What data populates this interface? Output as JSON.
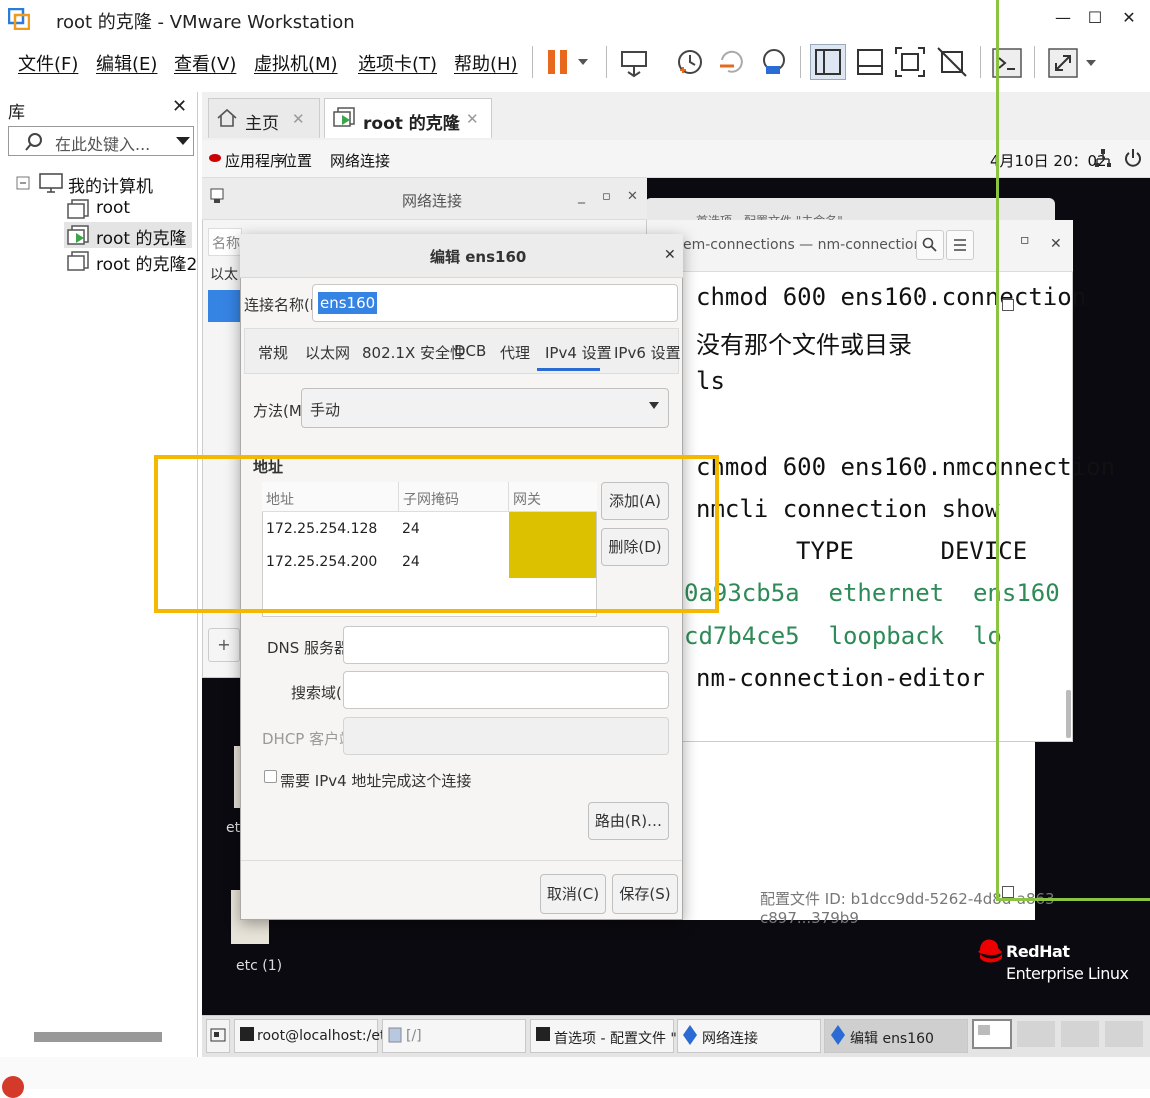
{
  "window": {
    "title": "root 的克隆 - VMware Workstation",
    "controls": [
      "—",
      "☐",
      "✕"
    ]
  },
  "menu": [
    "文件(F)",
    "编辑(E)",
    "查看(V)",
    "虚拟机(M)",
    "选项卡(T)",
    "帮助(H)"
  ],
  "library": {
    "title": "库",
    "close": "✕",
    "search_placeholder": "在此处键入...",
    "tree": {
      "root_label": "我的计算机",
      "items": [
        "root",
        "root 的克隆",
        "root 的克隆2"
      ]
    }
  },
  "tabs": [
    {
      "label": "主页",
      "close": "✕"
    },
    {
      "label": "root 的克隆",
      "close": "✕"
    }
  ],
  "guest_topbar": {
    "apps": "应用程序",
    "places": "位置",
    "net": "网络连接",
    "clock": "4月10日 20：02"
  },
  "terminal": {
    "title": "em-connections — nm-connection-editor",
    "behind_title": "首选项 - 配置文件 \"未命名\"",
    "lines": [
      {
        "text": "chmod 600 ens160.connection",
        "color": "normal"
      },
      {
        "text": "没有那个文件或目录",
        "color": "normal"
      },
      {
        "text": "ls",
        "color": "normal"
      },
      {
        "text": "chmod 600 ens160.nmconnection",
        "color": "normal"
      },
      {
        "text": "nmcli connection show",
        "color": "normal"
      },
      {
        "text": "TYPE      DEVICE",
        "color": "normal"
      },
      {
        "text": "0a93cb5a  ethernet  ens160",
        "color": "green"
      },
      {
        "text": "cd7b4ce5  loopback  lo",
        "color": "green"
      },
      {
        "text": "nm-connection-editor",
        "color": "normal"
      }
    ]
  },
  "prefs": {
    "file_id": "配置文件 ID:  b1dcc9dd-5262-4d8d-a863-c897...379b9"
  },
  "netwin": {
    "title": "网络连接",
    "name_col": "名称",
    "group": "以太",
    "add_btn": "+"
  },
  "dialog": {
    "title": "编辑 ens160",
    "close": "✕",
    "conn_name_label": "连接名称(N)",
    "conn_name_value": "ens160",
    "tabs": [
      "常规",
      "以太网",
      "802.1X 安全性",
      "DCB",
      "代理",
      "IPv4 设置",
      "IPv6 设置"
    ],
    "active_tab": "IPv4 设置",
    "method_label": "方法(M)",
    "method_value": "手动",
    "address_section": "地址",
    "addr_headers": [
      "地址",
      "子网掩码",
      "网关"
    ],
    "addresses": [
      {
        "address": "172.25.254.128",
        "mask": "24"
      },
      {
        "address": "172.25.254.200",
        "mask": "24"
      }
    ],
    "add_button": "添加(A)",
    "delete_button": "删除(D)",
    "dns_label": "DNS 服务器(V)",
    "search_label": "搜索域(E)",
    "dhcp_label": "DHCP 客户端 ID",
    "require_ipv4": "需要 IPv4 地址完成这个连接",
    "routes_button": "路由(R)…",
    "cancel_button": "取消(C)",
    "save_button": "保存(S)"
  },
  "desktop": {
    "icon1": "etc",
    "icon2": "etc (1)",
    "brand_line1": "RedHat",
    "brand_line2": "Enterprise Linux"
  },
  "taskbar": [
    "root@localhost:/etc/N…",
    "[/]",
    "首选项 - 配置文件 \"未…",
    "网络连接",
    "编辑 ens160"
  ],
  "colors": {
    "accent_orange": "#e8681d",
    "highlight_yellow": "#f5b800",
    "gateway_fill": "#dcc100",
    "selection_green": "#8ac440",
    "terminal_green": "#2e8b57",
    "tab_blue": "#2a6bd4"
  }
}
